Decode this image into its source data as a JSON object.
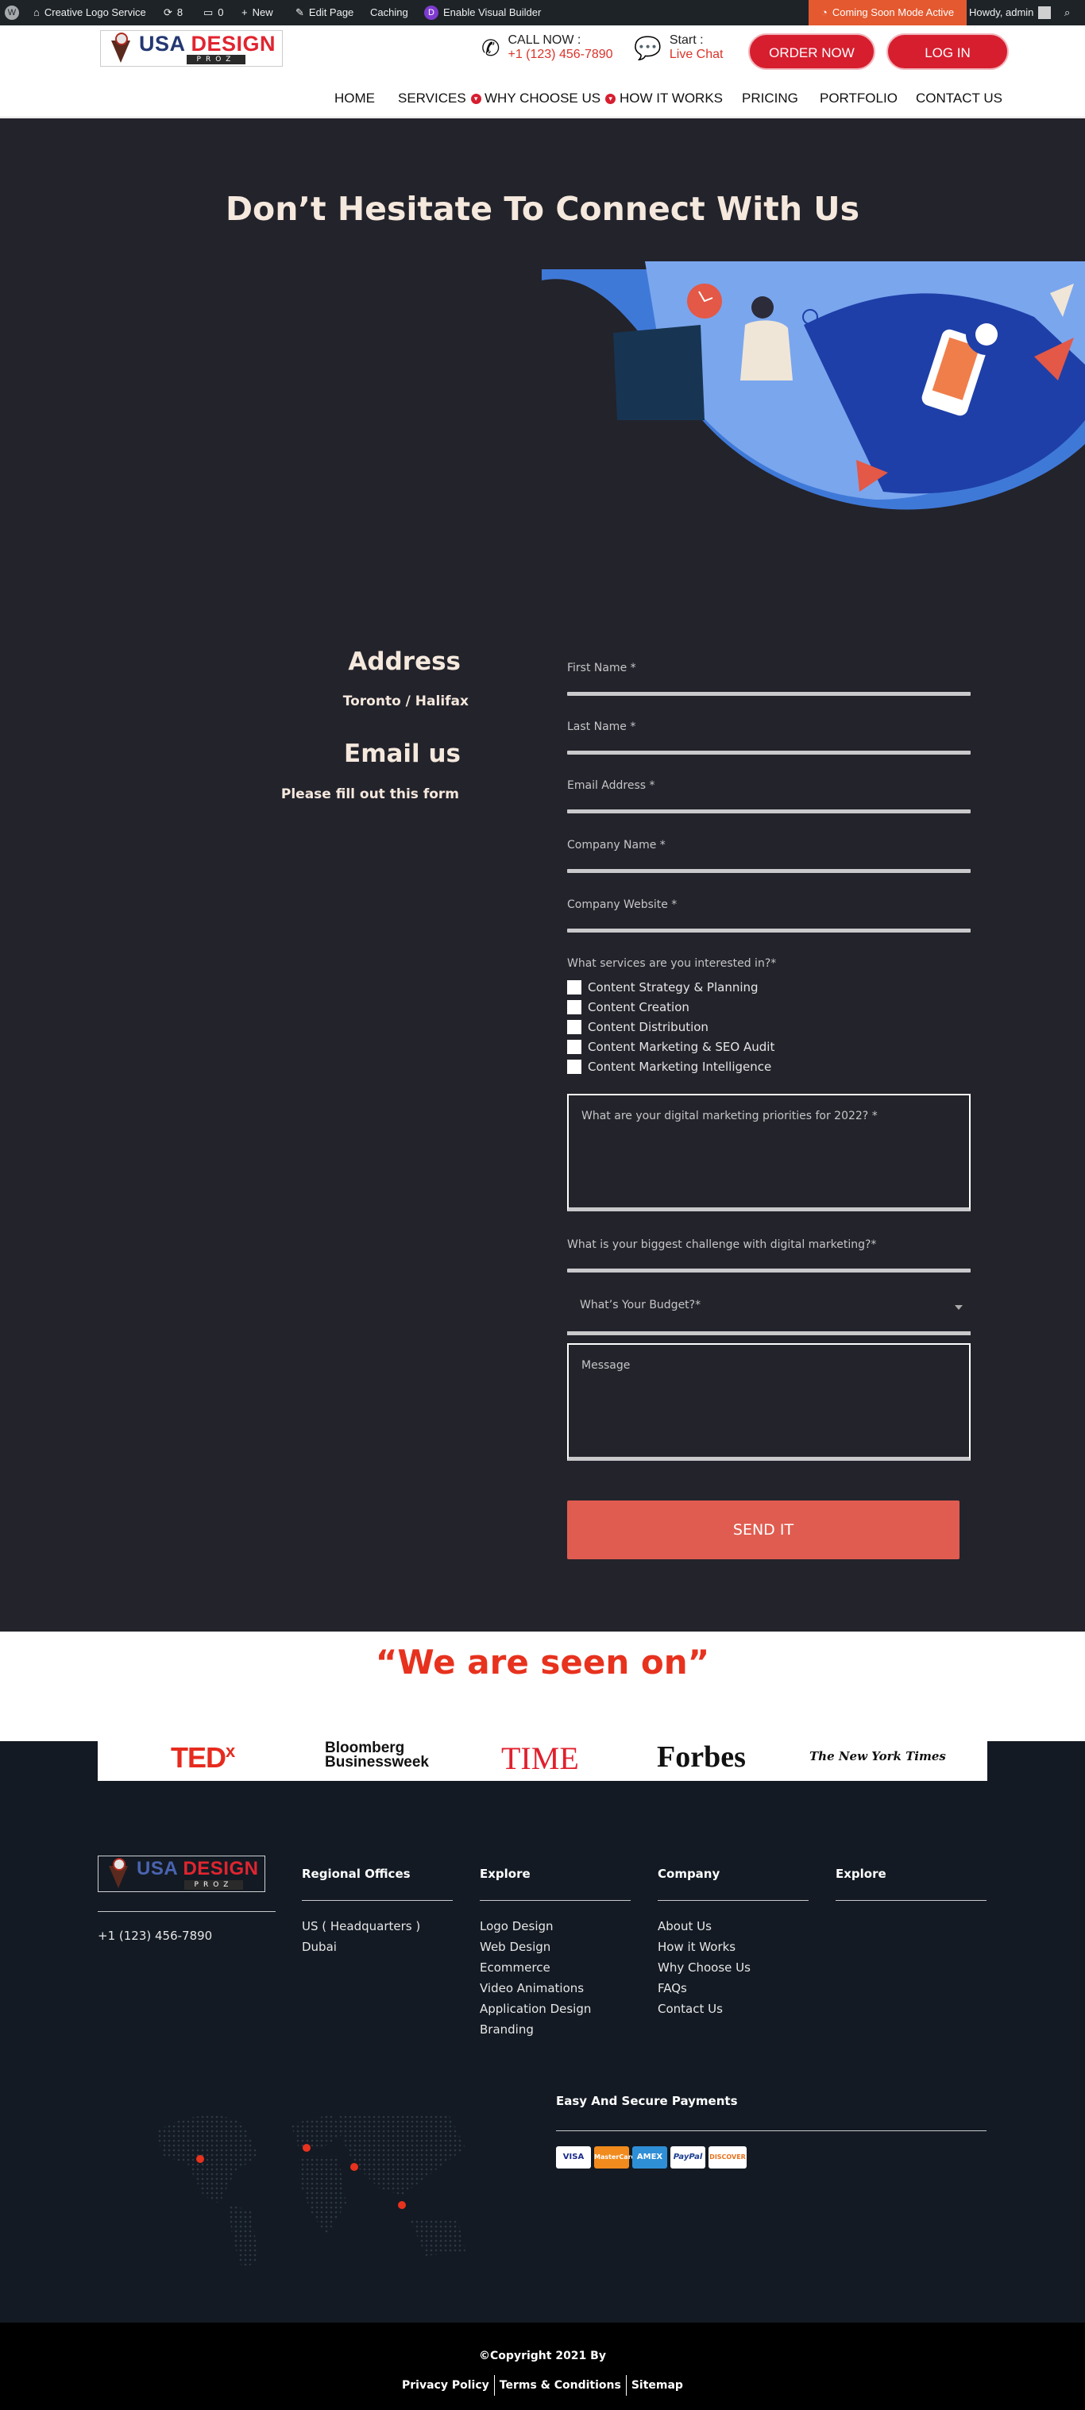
{
  "admin_bar": {
    "site_name": "Creative Logo Service",
    "updates_count": "8",
    "comments_count": "0",
    "new_label": "New",
    "edit_label": "Edit Page",
    "caching_label": "Caching",
    "visual_builder_label": "Enable Visual Builder",
    "coming_soon_label": "Coming Soon Mode Active",
    "howdy_label": "Howdy, admin"
  },
  "header": {
    "logo_usa": "USA",
    "logo_design": "DESIGN",
    "logo_sub": "PROZ",
    "call_label": "CALL NOW :",
    "call_number": "+1 (123) 456-7890",
    "chat_label": "Start :",
    "chat_link": "Live Chat",
    "order_button": "ORDER NOW",
    "login_button": "LOG IN"
  },
  "nav": {
    "items": [
      "HOME",
      "SERVICES",
      "WHY CHOOSE US",
      "HOW IT WORKS",
      "PRICING",
      "PORTFOLIO",
      "CONTACT US"
    ]
  },
  "contact": {
    "title": "Don’t Hesitate To Connect With Us",
    "address_heading": "Address",
    "address_text": "Toronto / Halifax",
    "email_heading": "Email us",
    "email_text": "Please fill out this form",
    "fields": {
      "first_name": "First Name *",
      "last_name": "Last Name *",
      "email": "Email Address *",
      "company": "Company Name *",
      "website": "Company Website *"
    },
    "services_question": "What services are you interested in?*",
    "services": [
      "Content Strategy & Planning",
      "Content Creation",
      "Content Distribution",
      "Content Marketing & SEO Audit",
      "Content Marketing Intelligence"
    ],
    "priorities_placeholder": "What are your digital marketing priorities for 2022?  *",
    "challenge_label": "What is your biggest challenge with digital marketing?*",
    "budget_placeholder": "What’s Your Budget?*",
    "message_placeholder": "Message",
    "send_button": "SEND IT"
  },
  "seen_on": {
    "title": "“We are seen on”",
    "logos": {
      "tedx_ted": "TED",
      "tedx_x": "x",
      "bloomberg_1": "Bloomberg",
      "bloomberg_2": "Businessweek",
      "time": "TIME",
      "forbes": "Forbes",
      "nyt": "The New York Times"
    }
  },
  "footer": {
    "phone": "+1 (123) 456-7890",
    "regional_heading": "Regional Offices",
    "regional_items": [
      "US ( Headquarters )",
      "Dubai"
    ],
    "explore_heading": "Explore",
    "explore_items": [
      "Logo Design",
      "Web Design",
      "Ecommerce",
      "Video Animations",
      "Application Design",
      "Branding"
    ],
    "company_heading": "Company",
    "company_items": [
      "About Us",
      "How it Works",
      "Why Choose Us",
      "FAQs",
      "Contact Us"
    ],
    "explore2_heading": "Explore",
    "payments_heading": "Easy And Secure Payments",
    "payment_cards": [
      "VISA",
      "MasterCard",
      "AMEX",
      "PayPal",
      "DISCOVER"
    ],
    "copyright": "©Copyright 2021 By",
    "bottom_links": [
      "Privacy Policy",
      "Terms & Conditions",
      "Sitemap"
    ]
  },
  "colors": {
    "accent_red": "#d61e2f",
    "dark_bg": "#23232b",
    "footer_bg": "#131a23",
    "send_button": "#e05c50",
    "seen_title": "#e7321e"
  }
}
